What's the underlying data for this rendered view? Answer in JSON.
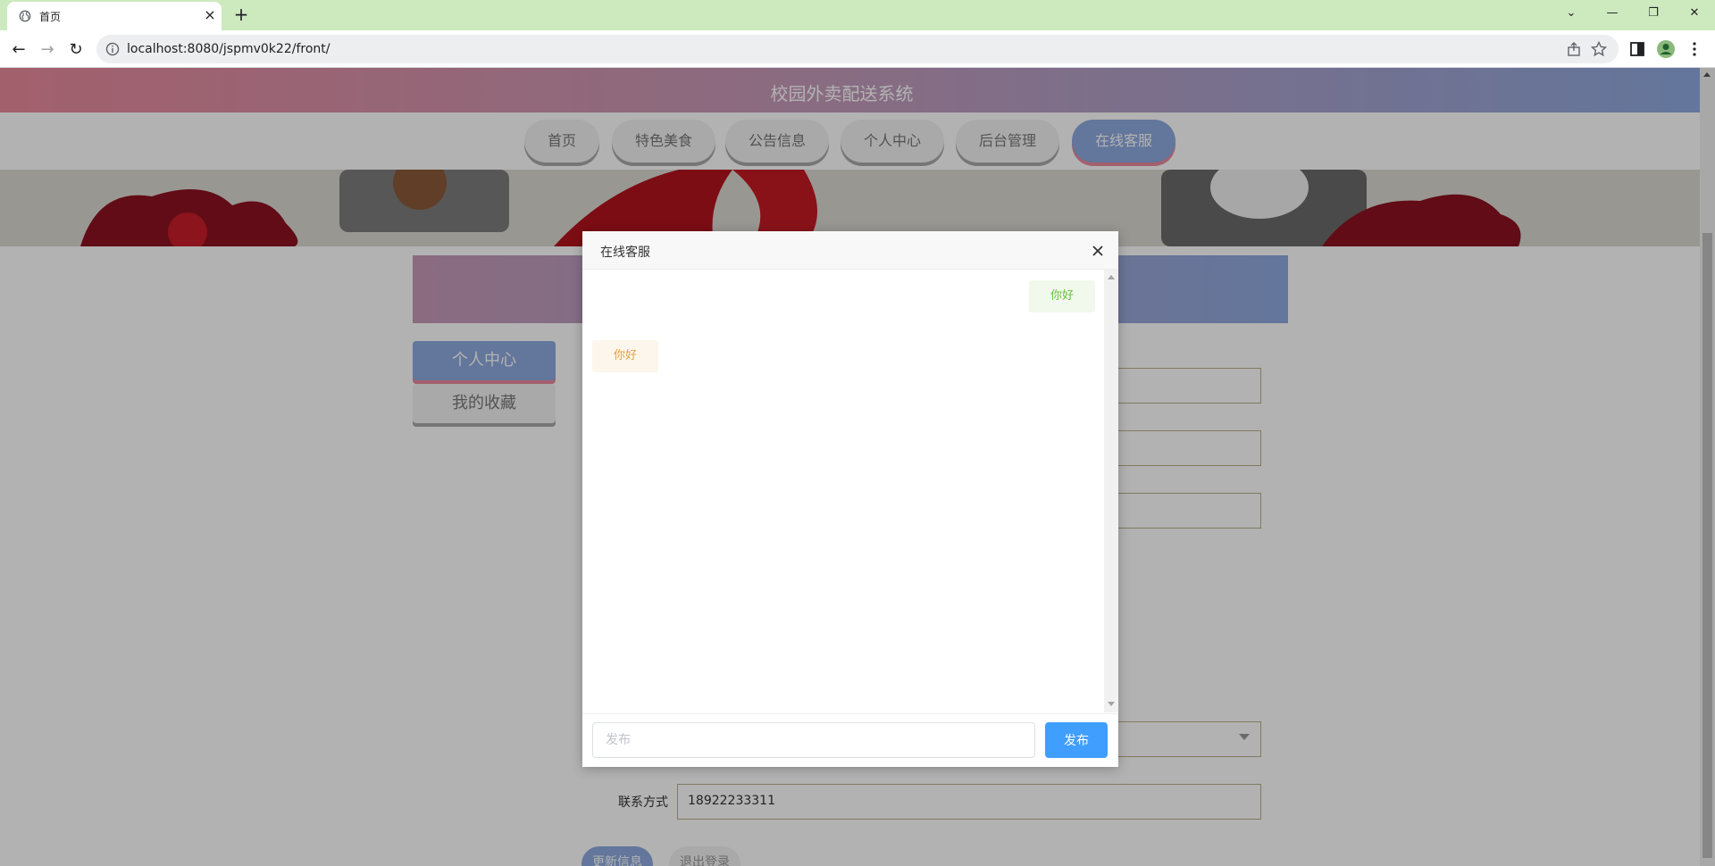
{
  "browser": {
    "tab_title": "首页",
    "tab_close": "×",
    "new_tab": "+",
    "url": "localhost:8080/jspmv0k22/front/",
    "window_controls": {
      "dropdown": "⌄",
      "minimize": "—",
      "restore": "❐",
      "close": "✕"
    },
    "nav": {
      "back": "←",
      "forward": "→",
      "reload": "↻"
    }
  },
  "site": {
    "title": "校园外卖配送系统",
    "menu": [
      "首页",
      "特色美食",
      "公告信息",
      "个人中心",
      "后台管理",
      "在线客服"
    ],
    "active_menu_index": 5,
    "sidebar": [
      "个人中心",
      "我的收藏"
    ],
    "contact_label": "联系方式",
    "contact_value": "18922233311",
    "update_button": "更新信息",
    "logout_button": "退出登录"
  },
  "dialog": {
    "title": "在线客服",
    "messages": [
      {
        "side": "right",
        "text": "你好"
      },
      {
        "side": "left",
        "text": "你好"
      }
    ],
    "input_placeholder": "发布",
    "send_label": "发布"
  },
  "colors": {
    "accent_blue": "#409eff",
    "header_pink": "#e98a9c",
    "header_blue": "#8fa9df",
    "reply_green": "#67c23a",
    "reply_orange": "#e6a23c"
  }
}
